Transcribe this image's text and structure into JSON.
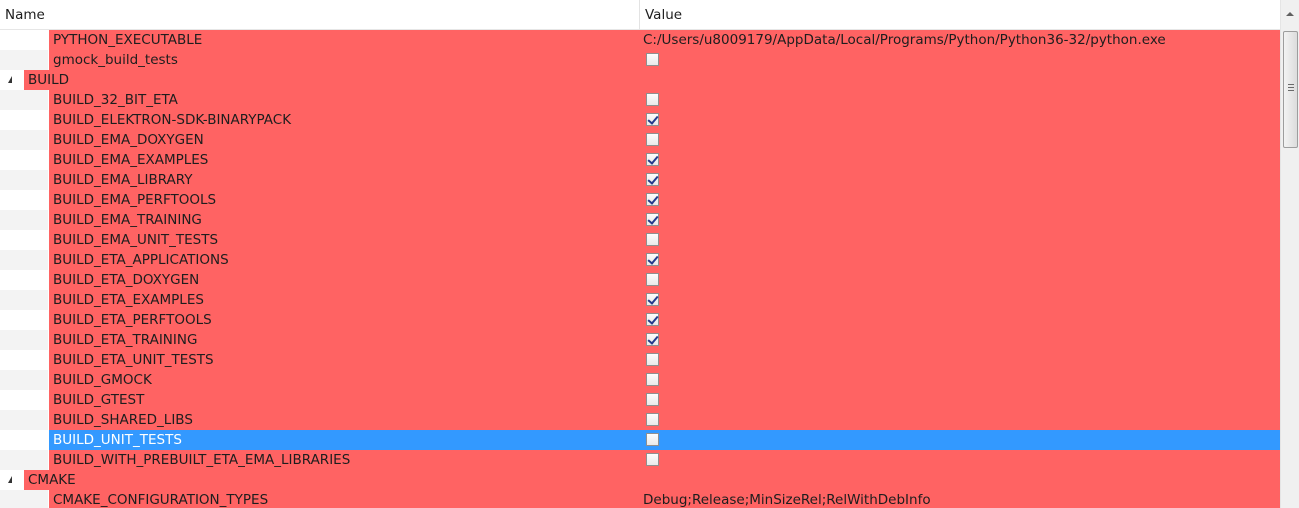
{
  "header": {
    "name": "Name",
    "value": "Value"
  },
  "rows": [
    {
      "kind": "item",
      "name": "PYTHON_EXECUTABLE",
      "value": "C:/Users/u8009179/AppData/Local/Programs/Python/Python36-32/python.exe"
    },
    {
      "kind": "item",
      "name": "gmock_build_tests",
      "checkbox": false
    },
    {
      "kind": "group",
      "name": "BUILD"
    },
    {
      "kind": "item",
      "name": "BUILD_32_BIT_ETA",
      "checkbox": false
    },
    {
      "kind": "item",
      "name": "BUILD_ELEKTRON-SDK-BINARYPACK",
      "checkbox": true
    },
    {
      "kind": "item",
      "name": "BUILD_EMA_DOXYGEN",
      "checkbox": false
    },
    {
      "kind": "item",
      "name": "BUILD_EMA_EXAMPLES",
      "checkbox": true
    },
    {
      "kind": "item",
      "name": "BUILD_EMA_LIBRARY",
      "checkbox": true
    },
    {
      "kind": "item",
      "name": "BUILD_EMA_PERFTOOLS",
      "checkbox": true
    },
    {
      "kind": "item",
      "name": "BUILD_EMA_TRAINING",
      "checkbox": true
    },
    {
      "kind": "item",
      "name": "BUILD_EMA_UNIT_TESTS",
      "checkbox": false
    },
    {
      "kind": "item",
      "name": "BUILD_ETA_APPLICATIONS",
      "checkbox": true
    },
    {
      "kind": "item",
      "name": "BUILD_ETA_DOXYGEN",
      "checkbox": false
    },
    {
      "kind": "item",
      "name": "BUILD_ETA_EXAMPLES",
      "checkbox": true
    },
    {
      "kind": "item",
      "name": "BUILD_ETA_PERFTOOLS",
      "checkbox": true
    },
    {
      "kind": "item",
      "name": "BUILD_ETA_TRAINING",
      "checkbox": true
    },
    {
      "kind": "item",
      "name": "BUILD_ETA_UNIT_TESTS",
      "checkbox": false
    },
    {
      "kind": "item",
      "name": "BUILD_GMOCK",
      "checkbox": false
    },
    {
      "kind": "item",
      "name": "BUILD_GTEST",
      "checkbox": false
    },
    {
      "kind": "item",
      "name": "BUILD_SHARED_LIBS",
      "checkbox": false
    },
    {
      "kind": "item",
      "name": "BUILD_UNIT_TESTS",
      "checkbox": false,
      "selected": true
    },
    {
      "kind": "item",
      "name": "BUILD_WITH_PREBUILT_ETA_EMA_LIBRARIES",
      "checkbox": false
    },
    {
      "kind": "group",
      "name": "CMAKE"
    },
    {
      "kind": "item",
      "name": "CMAKE_CONFIGURATION_TYPES",
      "value": "Debug;Release;MinSizeRel;RelWithDebInfo"
    }
  ],
  "colors": {
    "new_entry_background": "#ff6363",
    "selection_background": "#3399ff",
    "alternate_row": "#f3f3f3"
  },
  "icons": {
    "group_expander": "expanded-triangle-icon",
    "checkbox_checked": "checkmark-icon",
    "scroll_up": "scroll-up-arrow-icon",
    "scroll_grip": "grip-lines-icon"
  }
}
